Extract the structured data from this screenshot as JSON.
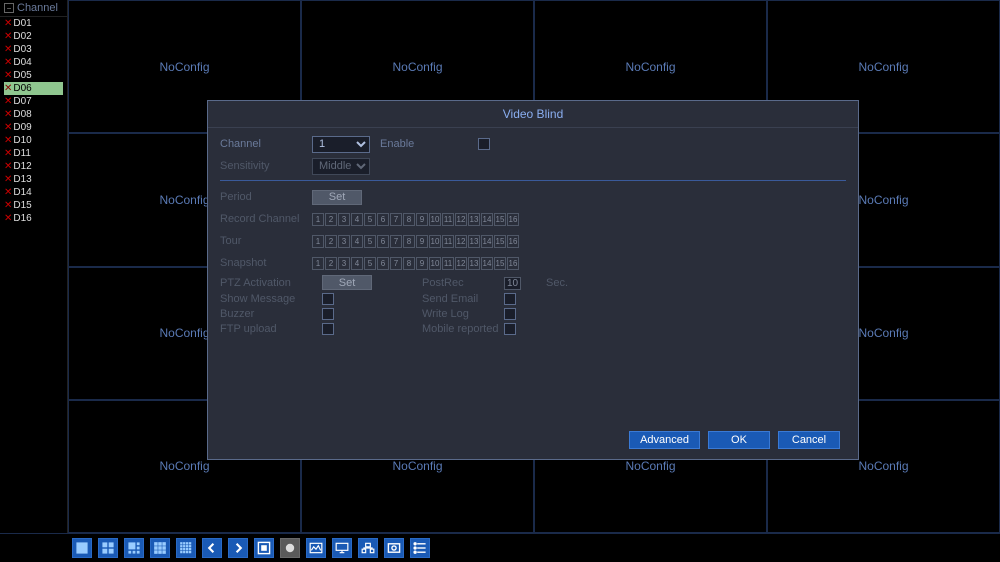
{
  "sidebar": {
    "title": "Channel",
    "channels": [
      "D01",
      "D02",
      "D03",
      "D04",
      "D05",
      "D06",
      "D07",
      "D08",
      "D09",
      "D10",
      "D11",
      "D12",
      "D13",
      "D14",
      "D15",
      "D16"
    ],
    "selectedIndex": 5
  },
  "grid": {
    "cell_label": "NoConfig"
  },
  "dialog": {
    "title": "Video Blind",
    "labels": {
      "channel": "Channel",
      "enable": "Enable",
      "sensitivity": "Sensitivity",
      "period": "Period",
      "record_channel": "Record Channel",
      "tour": "Tour",
      "snapshot": "Snapshot",
      "ptz": "PTZ Activation",
      "postrec": "PostRec",
      "seconds": "Sec.",
      "show_message": "Show Message",
      "send_email": "Send Email",
      "buzzer": "Buzzer",
      "write_log": "Write Log",
      "ftp_upload": "FTP upload",
      "mobile_reported": "Mobile reported",
      "set": "Set"
    },
    "values": {
      "channel": "1",
      "sensitivity": "Middle",
      "postrec": "10"
    },
    "numboxes": [
      "1",
      "2",
      "3",
      "4",
      "5",
      "6",
      "7",
      "8",
      "9",
      "10",
      "11",
      "12",
      "13",
      "14",
      "15",
      "16"
    ],
    "buttons": {
      "advanced": "Advanced",
      "ok": "OK",
      "cancel": "Cancel"
    }
  }
}
